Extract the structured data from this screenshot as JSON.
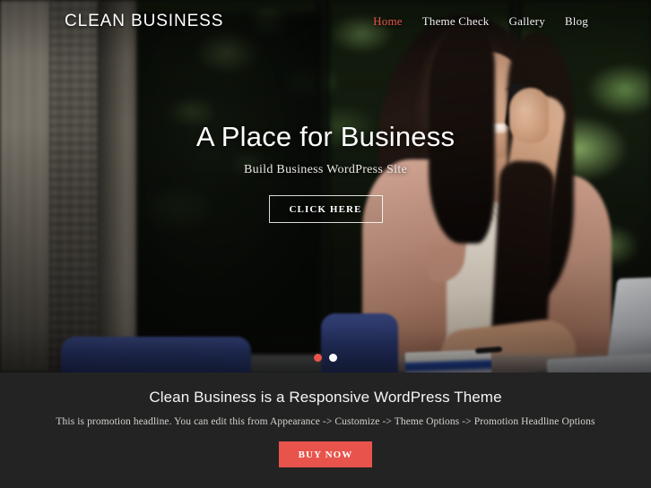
{
  "site": {
    "title": "CLEAN BUSINESS",
    "accent_color": "#e8544b",
    "promo_bg_color": "#232323"
  },
  "nav": {
    "items": [
      {
        "label": "Home",
        "active": true
      },
      {
        "label": "Theme Check",
        "active": false
      },
      {
        "label": "Gallery",
        "active": false
      },
      {
        "label": "Blog",
        "active": false
      }
    ]
  },
  "slider": {
    "title": "A Place for Business",
    "subtitle": "Build Business WordPress Site",
    "button_label": "CLICK HERE",
    "dots": [
      {
        "index": 1,
        "active": true
      },
      {
        "index": 2,
        "active": false
      }
    ]
  },
  "promotion": {
    "title": "Clean Business is a Responsive WordPress Theme",
    "description": "This is promotion headline. You can edit this from Appearance -> Customize -> Theme Options -> Promotion Headline Options",
    "button_label": "BUY NOW"
  }
}
